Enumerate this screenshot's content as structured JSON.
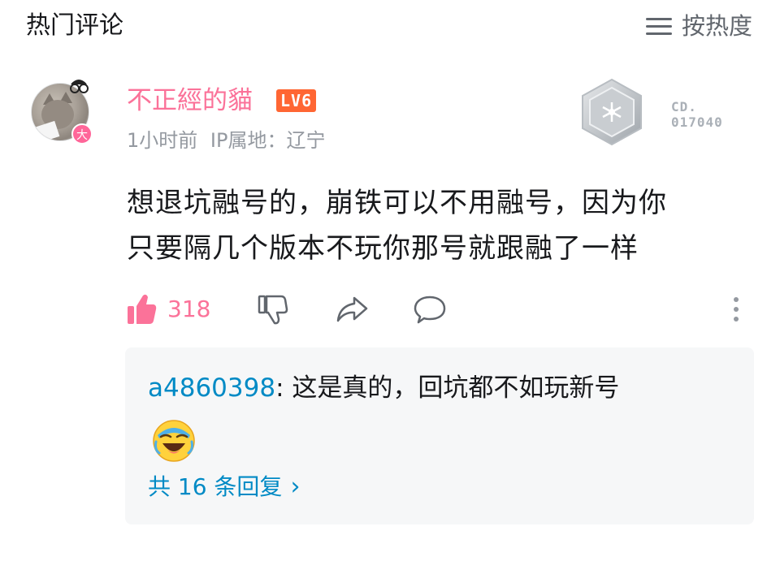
{
  "header": {
    "title": "热门评论",
    "sort_label": "按热度",
    "sort_icon": "list-sort-icon"
  },
  "comment": {
    "username": "不正經的貓",
    "level": "LV6",
    "time": "1小时前",
    "ip_location": "IP属地：辽宁",
    "avatar_badge": "大",
    "fan_badge_number": [
      "CD.",
      "017040"
    ],
    "text_lines": [
      "想退坑融号的，崩铁可以不用融号，因为你",
      "只要隔几个版本不玩你那号就跟融了一样"
    ],
    "likes": "318",
    "icons": [
      "thumbs-up-icon",
      "thumbs-down-icon",
      "share-icon",
      "reply-bubble-icon",
      "more-dots-icon"
    ]
  },
  "reply": {
    "user": "a4860398",
    "separator": ":",
    "text": " 这是真的，回坑都不如玩新号",
    "emoji": "laughing-crying-emoji",
    "more_label": "共 16 条回复",
    "more_chevron": "›"
  },
  "colors": {
    "pink": "#fb7299",
    "blue": "#008ac5",
    "level_orange": "#ff6633",
    "grey_text": "#9499a0",
    "reply_bg": "#f6f7f8"
  }
}
